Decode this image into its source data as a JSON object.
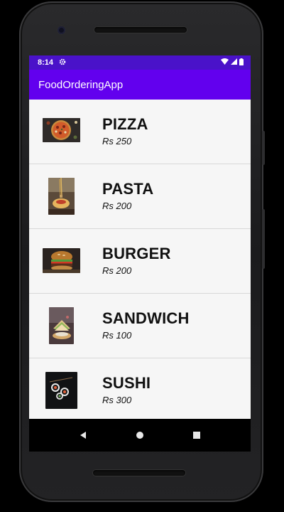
{
  "status_bar": {
    "time": "8:14",
    "icons": [
      "settings-icon",
      "wifi-icon",
      "signal-icon",
      "battery-icon"
    ]
  },
  "app_bar": {
    "title": "FoodOrderingApp",
    "color": "#6200ee",
    "status_color": "#4a12c9"
  },
  "menu": {
    "items": [
      {
        "name": "PIZZA",
        "price": "Rs 250",
        "image": "pizza-image"
      },
      {
        "name": "PASTA",
        "price": "Rs 200",
        "image": "pasta-image"
      },
      {
        "name": "BURGER",
        "price": "Rs 200",
        "image": "burger-image"
      },
      {
        "name": "SANDWICH",
        "price": "Rs 100",
        "image": "sandwich-image"
      },
      {
        "name": "SUSHI",
        "price": "Rs 300",
        "image": "sushi-image"
      }
    ]
  },
  "nav_bar": {
    "buttons": [
      "back-icon",
      "home-icon",
      "recents-icon"
    ]
  }
}
